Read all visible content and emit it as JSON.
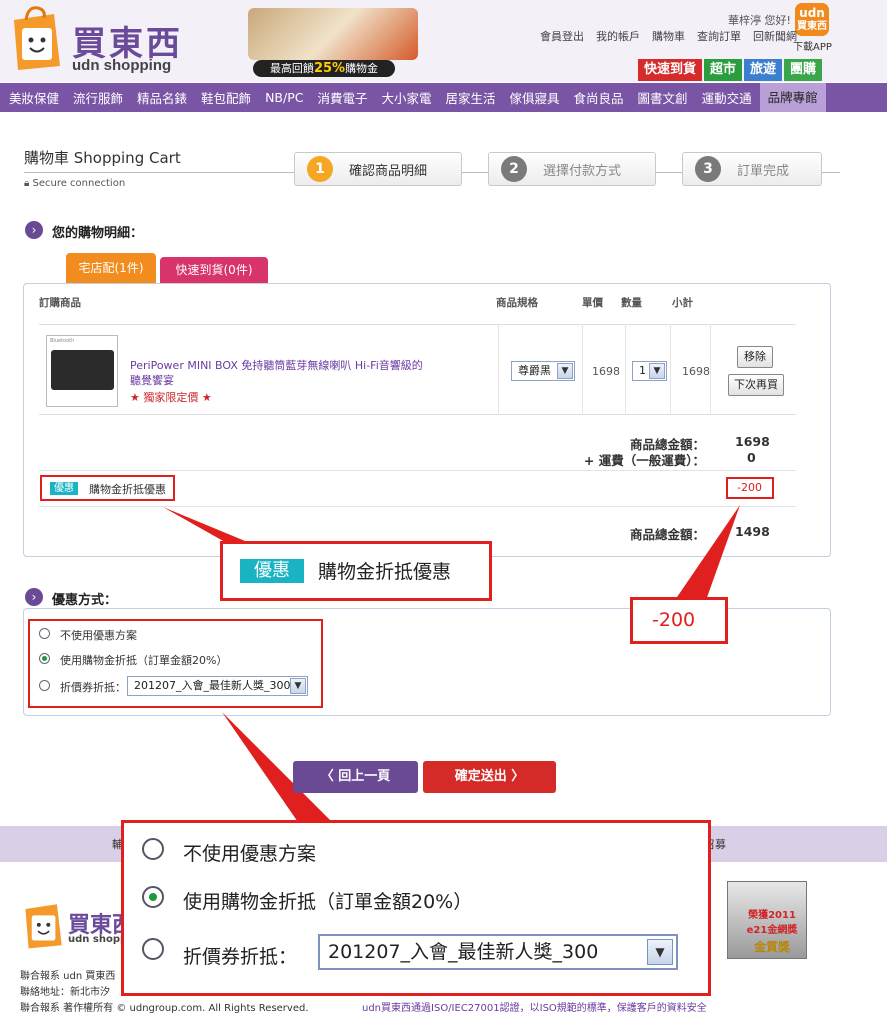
{
  "header": {
    "logo_cn": "買東西",
    "logo_en": "udn shopping",
    "banner_text_pre": "最高回饋",
    "banner_percent": "25%",
    "banner_text_post": "購物金",
    "greeting": "華梓渟 您好!",
    "app_icon_top": "udn",
    "app_icon_bottom": "買東西",
    "app_label": "下載APP",
    "top_links": [
      "會員登出",
      "我的帳戶",
      "購物車",
      "查詢訂單",
      "回新聞網"
    ],
    "pills": [
      {
        "label": "快速到貨",
        "color": "#d52b2b"
      },
      {
        "label": "超市",
        "color": "#2a9d3f"
      },
      {
        "label": "旅遊",
        "color": "#3b7fcf"
      },
      {
        "label": "團購",
        "color": "#3aa64a"
      }
    ]
  },
  "nav": {
    "items": [
      "美妝保健",
      "流行服飾",
      "精品名錶",
      "鞋包配飾",
      "NB/PC",
      "消費電子",
      "大小家電",
      "居家生活",
      "傢俱寢具",
      "食尚良品",
      "圖書文創",
      "運動交通"
    ],
    "last": "品牌專館"
  },
  "cart": {
    "title": "購物車 Shopping Cart",
    "secure": "Secure connection",
    "steps": [
      {
        "num": "1",
        "label": "確認商品明細"
      },
      {
        "num": "2",
        "label": "選擇付款方式"
      },
      {
        "num": "3",
        "label": "訂單完成"
      }
    ],
    "section_label": "您的購物明細：",
    "tabs": [
      "宅店配(1件)",
      "快速到貨(0件)"
    ],
    "columns": [
      "訂購商品",
      "商品規格",
      "單價",
      "數量",
      "小計"
    ],
    "item": {
      "image_label": "Bluetooth",
      "name": "PeriPower MINI BOX 免持聽筒藍芽無線喇叭 Hi-Fi音響級的聽覺饗宴",
      "tag": "★ 獨家限定價 ★",
      "spec": "尊爵黑",
      "price": "1698",
      "qty": "1",
      "subtotal": "1698",
      "remove_label": "移除",
      "later_label": "下次再買"
    },
    "total_label": "商品總金額：",
    "total_value": "1698",
    "shipping_label": "+ 運費（一般運費）：",
    "shipping_value": "0",
    "discount_badge": "優惠",
    "discount_text": "購物金折抵優惠",
    "discount_value": "-200",
    "final_label": "商品總金額：",
    "final_value": "1498"
  },
  "callouts": {
    "discount_badge": "優惠",
    "discount_text": "購物金折抵優惠",
    "value": "-200"
  },
  "offers": {
    "section_label": "優惠方式：",
    "options": [
      "不使用優惠方案",
      "使用購物金折抵（訂單金額20%）",
      "折價券折抵："
    ],
    "selected_index": 1,
    "coupon_value": "201207_入會_最佳新人獎_300"
  },
  "buttons": {
    "prev": "〈  回上一頁",
    "submit": "確定送出  〉"
  },
  "footer": {
    "logo_cn": "買東西",
    "logo_en": "udn shopping",
    "line1": "聯合報系 udn 買東西",
    "line2": "聯絡地址：新北市汐",
    "line3": "聯合報系   著作權所有 © udngroup.com.   All Rights Reserved.",
    "iso": "udn買東西通過ISO/IEC27001認證，以ISO規範的標準，保護客戶的資料安全",
    "award_line1": "榮獲2011",
    "award_line2": "e21金網獎",
    "award_line3": "金質獎",
    "partial_left": "輔",
    "partial_right": "召募"
  },
  "colors": {
    "purple": "#7a55a5",
    "red": "#e0201e",
    "orange": "#f5a623",
    "teal": "#19b3c4"
  }
}
